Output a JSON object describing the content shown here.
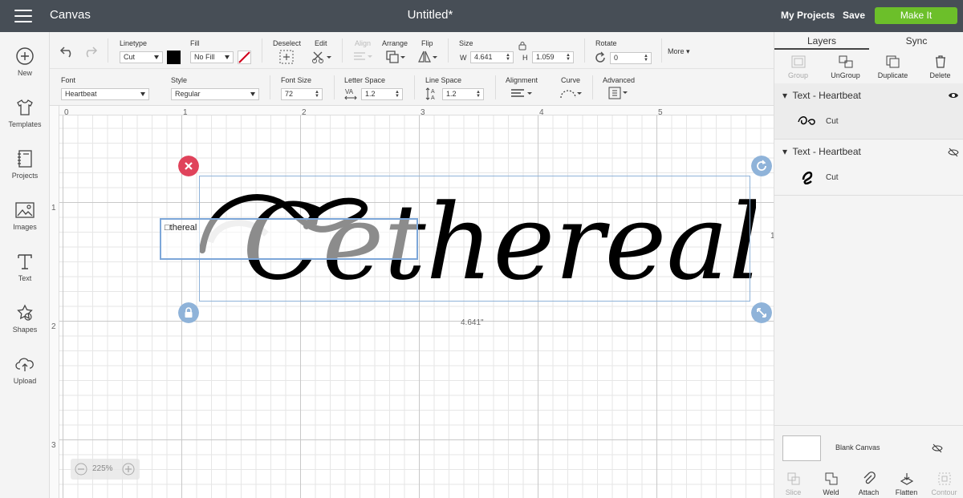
{
  "topbar": {
    "app_title": "Canvas",
    "doc_title": "Untitled*",
    "my_projects": "My Projects",
    "save": "Save",
    "make_it": "Make It",
    "make_it_color": "#6cbf2a"
  },
  "sidebar": {
    "items": [
      {
        "label": "New",
        "icon": "plus-circle-icon"
      },
      {
        "label": "Templates",
        "icon": "shirt-icon"
      },
      {
        "label": "Projects",
        "icon": "notebook-icon"
      },
      {
        "label": "Images",
        "icon": "image-icon"
      },
      {
        "label": "Text",
        "icon": "text-t-icon"
      },
      {
        "label": "Shapes",
        "icon": "shapes-icon"
      },
      {
        "label": "Upload",
        "icon": "cloud-upload-icon"
      }
    ]
  },
  "toolbar1": {
    "linetype_label": "Linetype",
    "linetype_value": "Cut",
    "fill_label": "Fill",
    "fill_value": "No Fill",
    "deselect_label": "Deselect",
    "edit_label": "Edit",
    "align_label": "Align",
    "arrange_label": "Arrange",
    "flip_label": "Flip",
    "size_label": "Size",
    "w_label": "W",
    "w_value": "4.641",
    "h_label": "H",
    "h_value": "1.059",
    "rotate_label": "Rotate",
    "rotate_value": "0",
    "more_label": "More"
  },
  "toolbar2": {
    "font_label": "Font",
    "font_value": "Heartbeat",
    "style_label": "Style",
    "style_value": "Regular",
    "font_size_label": "Font Size",
    "font_size_value": "72",
    "letter_space_label": "Letter Space",
    "letter_space_value": "1.2",
    "line_space_label": "Line Space",
    "line_space_value": "1.2",
    "alignment_label": "Alignment",
    "curve_label": "Curve",
    "advanced_label": "Advanced"
  },
  "canvas": {
    "ruler_top": [
      "0",
      "1",
      "2",
      "3",
      "4",
      "5"
    ],
    "ruler_left": [
      "1",
      "2",
      "3"
    ],
    "display_text": "Cethereal",
    "edit_text": "thereal",
    "width_label": "4.641\"",
    "zoom_value": "225%",
    "side_mark": "1"
  },
  "panel": {
    "tabs": [
      "Layers",
      "Sync"
    ],
    "actions": [
      {
        "label": "Group",
        "icon": "group-icon",
        "enabled": false
      },
      {
        "label": "UnGroup",
        "icon": "ungroup-icon",
        "enabled": true
      },
      {
        "label": "Duplicate",
        "icon": "duplicate-icon",
        "enabled": true
      },
      {
        "label": "Delete",
        "icon": "trash-icon",
        "enabled": true
      }
    ],
    "layers": [
      {
        "title": "Text - Heartbeat",
        "sub": "Cut",
        "visible": true
      },
      {
        "title": "Text - Heartbeat",
        "sub": "Cut",
        "visible": false
      }
    ],
    "blank_canvas": "Blank Canvas",
    "bottom_actions": [
      {
        "label": "Slice",
        "enabled": false
      },
      {
        "label": "Weld",
        "enabled": true
      },
      {
        "label": "Attach",
        "enabled": true
      },
      {
        "label": "Flatten",
        "enabled": true
      },
      {
        "label": "Contour",
        "enabled": false
      }
    ]
  }
}
